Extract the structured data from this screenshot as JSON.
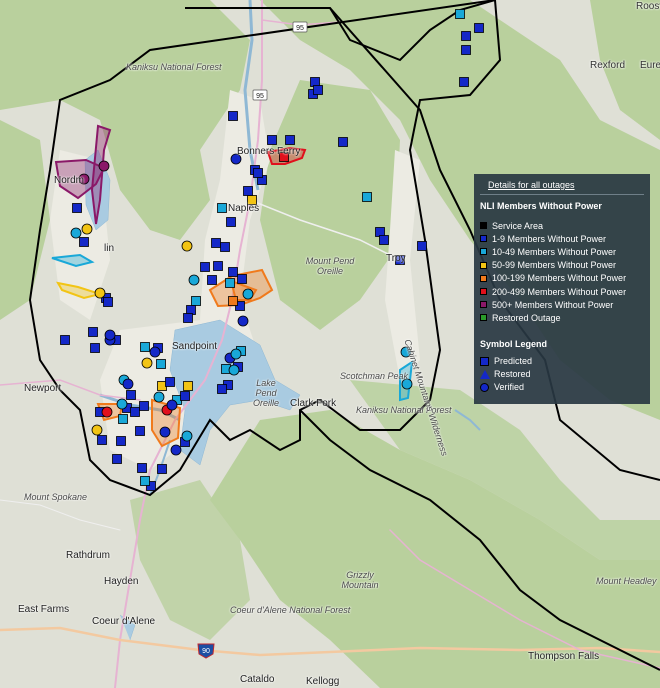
{
  "map": {
    "colors": {
      "water": "#a8cbe0",
      "forest": "#b7cf9c",
      "terrain": "#dfe0d6",
      "boundary": "#000000",
      "road": "#e8a9d6",
      "interstate": "#f3c9a0"
    },
    "place_labels": {
      "roosville": "Roosvi",
      "kaniksu_nf": "Kaniksu National Forest",
      "rexford": "Rexford",
      "eureka": "Eureka",
      "bonners_ferry": "Bonners Ferry",
      "naples": "Naples",
      "nordman": "Nordm",
      "priest_river_lin": "lin",
      "mount_pend_oreille": "Mount Pend Oreille",
      "troy": "Troy",
      "sandpoint": "Sandpoint",
      "scotchman_peak": "Scotchman Peak",
      "newport": "Newport",
      "lake_pend_oreille": "Lake Pend Oreille",
      "clark_fork": "Clark Fork",
      "kaniksu_nf_2": "Kaniksu National Forest",
      "cabinet_wilderness": "Cabinet Mountains Wilderness",
      "mount_spokane": "Mount Spokane",
      "rathdrum": "Rathdrum",
      "hayden": "Hayden",
      "grizzly_mountain": "Grizzly Mountain",
      "mount_headley": "Mount Headley",
      "east_farms": "East Farms",
      "coeur_dalene": "Coeur d'Alene",
      "coeur_dalene_nf": "Coeur d'Alene National Forest",
      "thompson_falls": "Thompson Falls",
      "cataldo": "Cataldo",
      "kellogg": "Kellogg"
    },
    "highway_shields": {
      "hwy95_north": "95",
      "hwy95_mid": "95",
      "i90": "90"
    },
    "outage_squares": [
      {
        "s": "1-9"
      },
      {
        "s": "1-9"
      },
      {
        "s": "1-9"
      },
      {
        "s": "1-9"
      },
      {
        "s": "10-49"
      },
      {
        "s": "1-9"
      },
      {
        "s": "1-9"
      },
      {
        "s": "1-9"
      },
      {
        "s": "1-9"
      },
      {
        "s": "200-499"
      },
      {
        "s": "1-9"
      },
      {
        "s": "1-9"
      },
      {
        "s": "1-9"
      },
      {
        "s": "1-9"
      },
      {
        "s": "10-49"
      },
      {
        "s": "50-99"
      },
      {
        "s": "1-9"
      },
      {
        "s": "1-9"
      },
      {
        "s": "1-9"
      },
      {
        "s": "10-49"
      },
      {
        "s": "1-9"
      },
      {
        "s": "1-9"
      },
      {
        "s": "1-9"
      },
      {
        "s": "10-49"
      },
      {
        "s": "1-9"
      },
      {
        "s": "1-9"
      },
      {
        "s": "1-9"
      },
      {
        "s": "1-9"
      },
      {
        "s": "10-49"
      },
      {
        "s": "1-9"
      },
      {
        "s": "1-9"
      },
      {
        "s": "100-199"
      },
      {
        "s": "1-9"
      },
      {
        "s": "1-9"
      },
      {
        "s": "1-9"
      },
      {
        "s": "1-9"
      },
      {
        "s": "1-9"
      },
      {
        "s": "1-9"
      },
      {
        "s": "1-9"
      },
      {
        "s": "1-9"
      },
      {
        "s": "1-9"
      },
      {
        "s": "1-9"
      },
      {
        "s": "10-49"
      },
      {
        "s": "1-9"
      },
      {
        "s": "10-49"
      },
      {
        "s": "50-99"
      },
      {
        "s": "1-9"
      },
      {
        "s": "10-49"
      },
      {
        "s": "1-9"
      },
      {
        "s": "50-99"
      },
      {
        "s": "1-9"
      },
      {
        "s": "1-9"
      },
      {
        "s": "1-9"
      },
      {
        "s": "1-9"
      },
      {
        "s": "10-49"
      },
      {
        "s": "1-9"
      },
      {
        "s": "1-9"
      },
      {
        "s": "1-9"
      },
      {
        "s": "1-9"
      },
      {
        "s": "1-9"
      },
      {
        "s": "1-9"
      },
      {
        "s": "1-9"
      },
      {
        "s": "10-49"
      },
      {
        "s": "1-9"
      },
      {
        "s": "1-9"
      },
      {
        "s": "10-49"
      },
      {
        "s": "1-9"
      },
      {
        "s": "10-49"
      },
      {
        "s": "1-9"
      },
      {
        "s": "1-9"
      },
      {
        "s": "1-9"
      },
      {
        "s": "1-9"
      },
      {
        "s": "1-9"
      },
      {
        "s": "1-9"
      }
    ],
    "outage_circles": [
      {
        "s": "1-9"
      },
      {
        "s": "1-9"
      },
      {
        "s": "500+"
      },
      {
        "s": "500+"
      },
      {
        "s": "50-99"
      },
      {
        "s": "10-49"
      },
      {
        "s": "50-99"
      },
      {
        "s": "50-99"
      },
      {
        "s": "10-49"
      },
      {
        "s": "10-49"
      },
      {
        "s": "1-9"
      },
      {
        "s": "1-9"
      },
      {
        "s": "10-49"
      },
      {
        "s": "10-49"
      },
      {
        "s": "1-9"
      },
      {
        "s": "200-499"
      },
      {
        "s": "200-499"
      },
      {
        "s": "50-99"
      },
      {
        "s": "10-49"
      },
      {
        "s": "1-9"
      },
      {
        "s": "10-49"
      },
      {
        "s": "10-49"
      },
      {
        "s": "1-9"
      },
      {
        "s": "10-49"
      },
      {
        "s": "1-9"
      },
      {
        "s": "1-9"
      },
      {
        "s": "10-49"
      },
      {
        "s": "10-49"
      },
      {
        "s": "1-9"
      },
      {
        "s": "50-99"
      }
    ],
    "outage_areas": [
      {
        "s": "500+"
      },
      {
        "s": "500+"
      },
      {
        "s": "100-199"
      },
      {
        "s": "100-199"
      },
      {
        "s": "200-499"
      },
      {
        "s": "10-49"
      },
      {
        "s": "50-99"
      },
      {
        "s": "100-199"
      },
      {
        "s": "100-199"
      },
      {
        "s": "10-49"
      }
    ]
  },
  "legend": {
    "details_link": "Details for all outages",
    "title": "NLI Members Without Power",
    "severity": [
      {
        "key": "service",
        "label": "Service Area",
        "color": "#000000"
      },
      {
        "key": "1-9",
        "label": "1-9 Members Without Power",
        "color": "#1428c8"
      },
      {
        "key": "10-49",
        "label": "10-49 Members Without Power",
        "color": "#19a8d8"
      },
      {
        "key": "50-99",
        "label": "50-99 Members Without Power",
        "color": "#f2c414"
      },
      {
        "key": "100-199",
        "label": "100-199 Members Without Power",
        "color": "#f07a1c"
      },
      {
        "key": "200-499",
        "label": "200-499 Members Without Power",
        "color": "#e0101c"
      },
      {
        "key": "500+",
        "label": "500+ Members Without Power",
        "color": "#8a1868"
      },
      {
        "key": "restored",
        "label": "Restored Outage",
        "color": "#2a9a2a"
      }
    ],
    "symbol_title": "Symbol Legend",
    "symbols": [
      {
        "label": "Predicted",
        "icon": "square-icon"
      },
      {
        "label": "Restored",
        "icon": "triangle-icon"
      },
      {
        "label": "Verified",
        "icon": "circle-icon"
      }
    ]
  }
}
